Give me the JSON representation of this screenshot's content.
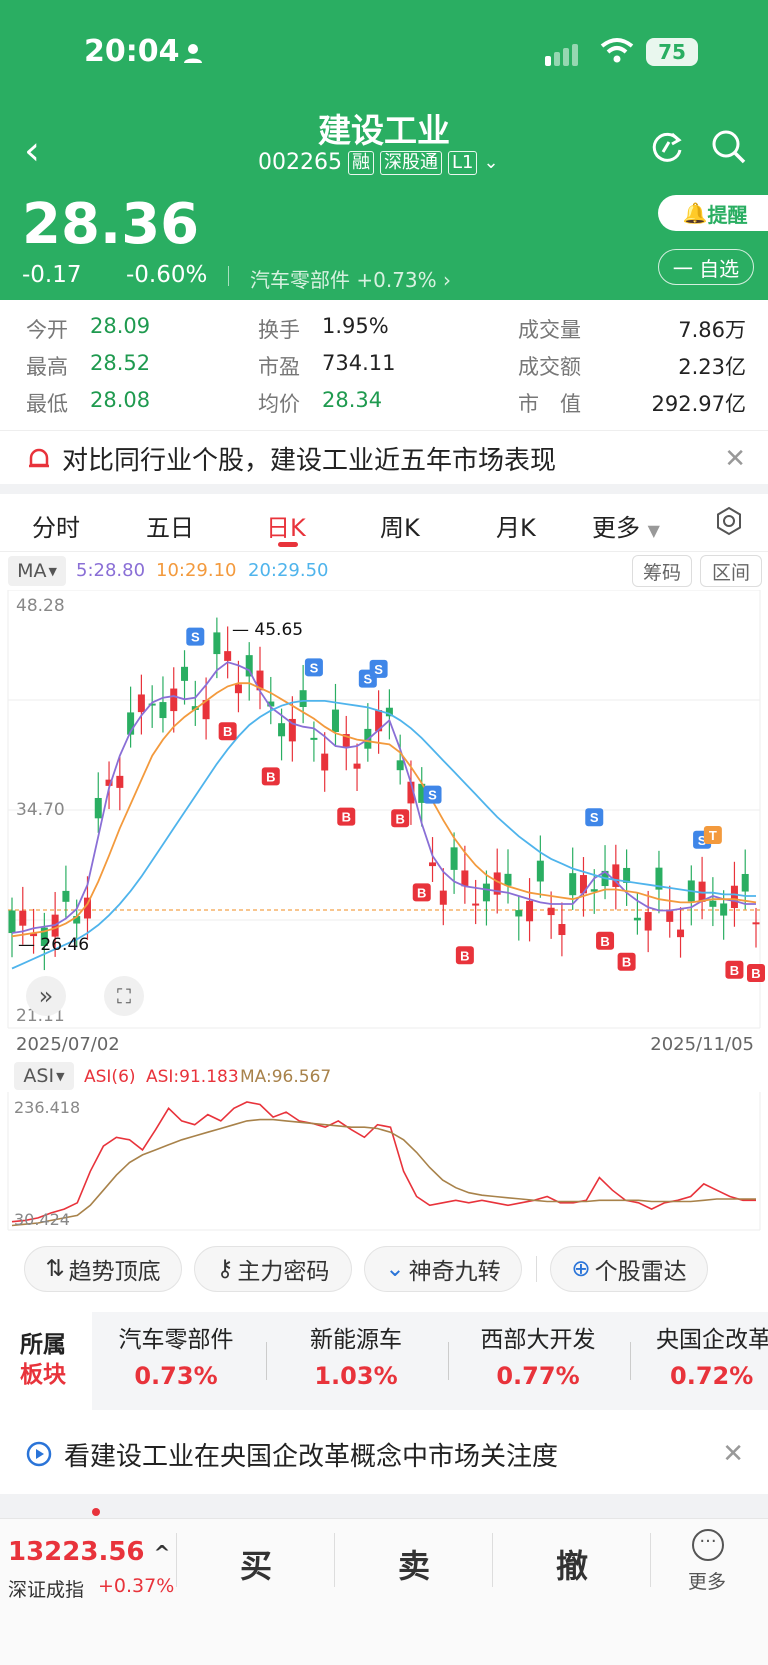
{
  "status": {
    "time": "20:04",
    "battery": "75"
  },
  "header": {
    "title": "建设工业",
    "code": "002265",
    "tags": [
      "融",
      "深股通",
      "L1"
    ],
    "price": "28.36",
    "change": "-0.17",
    "change_pct": "-0.60%",
    "sector": "汽车零部件 +0.73% ›",
    "remind_label": "提醒",
    "fav_label": "一 自选"
  },
  "stats": {
    "open_label": "今开",
    "open": "28.09",
    "high_label": "最高",
    "high": "28.52",
    "low_label": "最低",
    "low": "28.08",
    "turnover_label": "换手",
    "turnover": "1.95%",
    "pe_label": "市盈",
    "pe": "734.11",
    "avg_label": "均价",
    "avg": "28.34",
    "volume_label": "成交量",
    "volume": "7.86万",
    "amount_label": "成交额",
    "amount": "2.23亿",
    "mcap_label": "市　值",
    "mcap": "292.97亿"
  },
  "banner1": "对比同行业个股，建设工业近五年市场表现",
  "tabs": [
    "分时",
    "五日",
    "日K",
    "周K",
    "月K",
    "更多"
  ],
  "active_tab": "日K",
  "ma": {
    "label": "MA",
    "ma5": "5:28.80",
    "ma10": "10:29.10",
    "ma20": "20:29.50",
    "btn1": "筹码",
    "btn2": "区间"
  },
  "ylabels": {
    "top": "48.28",
    "mid": "34.70",
    "bottom": "21.11"
  },
  "marks": {
    "hi": "45.65",
    "lo": "26.46"
  },
  "dates": {
    "start": "2025/07/02",
    "end": "2025/11/05"
  },
  "asi": {
    "label": "ASI",
    "name": "ASI(6)",
    "value": "ASI:91.183",
    "ma": "MA:96.567",
    "top": "236.418",
    "bottom": "30.424"
  },
  "indicators": [
    "趋势顶底",
    "主力密码",
    "神奇九转",
    "个股雷达"
  ],
  "sector_panel": {
    "title1": "所属",
    "title2": "板块",
    "items": [
      {
        "name": "汽车零部件",
        "pct": "0.73%"
      },
      {
        "name": "新能源车",
        "pct": "1.03%"
      },
      {
        "name": "西部大开发",
        "pct": "0.77%"
      },
      {
        "name": "央国企改革",
        "pct": "0.72%"
      }
    ]
  },
  "banner2": "看建设工业在央国企改革概念中市场关注度",
  "footer": {
    "index_value": "13223.56",
    "index_name": "深证成指",
    "index_chg": "+0.37%",
    "buy": "买",
    "sell": "卖",
    "cancel": "撤",
    "more": "更多"
  },
  "colors": {
    "green": "#2aae62",
    "red": "#e8333b",
    "ma5": "#8a6fd6",
    "ma10": "#f39a3d",
    "ma20": "#4fb4ec"
  },
  "chart_data": {
    "type": "candlestick",
    "ylim": [
      21.11,
      48.28
    ],
    "ma_series": [
      {
        "name": "MA5",
        "values": [
          27,
          27.1,
          27.3,
          27.4,
          27.5,
          27.9,
          28.5,
          30,
          33,
          36,
          38,
          39.5,
          40.5,
          41.3,
          41.6,
          41.7,
          41.5,
          41.6,
          42.4,
          43.3,
          43.8,
          43.6,
          43.3,
          42,
          41,
          40.5,
          40,
          39.8,
          39.7,
          39.2,
          38.6,
          38.5,
          38.6,
          39,
          39.6,
          40.2,
          38.4,
          36.3,
          33.8,
          31.8,
          30.8,
          30.2,
          29.9,
          29.8,
          29.7,
          29.6,
          29.5,
          29.3,
          29.1,
          28.9,
          28.8,
          28.8,
          28.8,
          29.5,
          30.4,
          30.8,
          30.2,
          29.5,
          29,
          28.6,
          28.4,
          28.4,
          28.5,
          28.6,
          29,
          29.3,
          29.1,
          29,
          28.8,
          28.8
        ]
      },
      {
        "name": "MA10",
        "values": [
          26.8,
          26.9,
          27,
          27.1,
          27.3,
          27.6,
          28,
          28.8,
          30.2,
          31.8,
          33.5,
          35,
          36.5,
          38,
          39,
          39.8,
          40.4,
          40.9,
          41.4,
          41.9,
          42.3,
          42.5,
          42.5,
          42.2,
          41.9,
          41.5,
          41.1,
          40.7,
          40.3,
          39.8,
          39.4,
          39.2,
          39,
          38.9,
          38.8,
          38.7,
          38.2,
          37.3,
          36.3,
          35.2,
          34,
          32.9,
          32,
          31.2,
          30.6,
          30.2,
          29.9,
          29.7,
          29.5,
          29.4,
          29.3,
          29.2,
          29.1,
          29.3,
          29.5,
          29.7,
          29.7,
          29.6,
          29.5,
          29.3,
          29.1,
          29,
          28.9,
          28.9,
          29,
          29.1,
          29.1,
          29.1,
          29,
          28.9
        ]
      },
      {
        "name": "MA20",
        "values": [
          24.8,
          25.1,
          25.4,
          25.7,
          26,
          26.3,
          26.6,
          27,
          27.5,
          28.1,
          28.8,
          29.6,
          30.5,
          31.5,
          32.5,
          33.5,
          34.5,
          35.5,
          36.5,
          37.5,
          38.4,
          39.2,
          39.9,
          40.4,
          40.8,
          41.1,
          41.3,
          41.4,
          41.4,
          41.4,
          41.3,
          41.2,
          41.1,
          41,
          40.8,
          40.6,
          40.2,
          39.7,
          39.1,
          38.4,
          37.7,
          37,
          36.3,
          35.6,
          34.9,
          34.2,
          33.6,
          33,
          32.5,
          32,
          31.6,
          31.3,
          31,
          30.8,
          30.6,
          30.4,
          30.3,
          30.2,
          30.1,
          30,
          29.9,
          29.8,
          29.7,
          29.6,
          29.5,
          29.5,
          29.4,
          29.4,
          29.3,
          29.3
        ]
      }
    ],
    "asi_series": [
      {
        "name": "ASI(6)",
        "values": [
          0.05,
          0.06,
          0.08,
          0.12,
          0.15,
          0.2,
          0.45,
          0.65,
          0.72,
          0.7,
          0.62,
          0.78,
          0.95,
          0.85,
          0.82,
          0.9,
          0.85,
          0.95,
          1.0,
          0.98,
          0.88,
          0.92,
          0.85,
          0.83,
          0.8,
          0.85,
          0.78,
          0.72,
          0.82,
          0.8,
          0.45,
          0.25,
          0.18,
          0.2,
          0.22,
          0.2,
          0.22,
          0.2,
          0.18,
          0.2,
          0.22,
          0.25,
          0.2,
          0.2,
          0.22,
          0.4,
          0.3,
          0.22,
          0.2,
          0.15,
          0.2,
          0.22,
          0.25,
          0.35,
          0.3,
          0.25,
          0.22,
          0.22
        ]
      },
      {
        "name": "MA",
        "values": [
          0.02,
          0.03,
          0.04,
          0.06,
          0.08,
          0.1,
          0.18,
          0.3,
          0.42,
          0.52,
          0.58,
          0.62,
          0.66,
          0.7,
          0.73,
          0.76,
          0.79,
          0.82,
          0.85,
          0.86,
          0.86,
          0.85,
          0.84,
          0.83,
          0.82,
          0.81,
          0.8,
          0.8,
          0.79,
          0.76,
          0.7,
          0.6,
          0.48,
          0.38,
          0.32,
          0.28,
          0.26,
          0.25,
          0.24,
          0.23,
          0.22,
          0.21,
          0.21,
          0.21,
          0.21,
          0.22,
          0.22,
          0.22,
          0.22,
          0.21,
          0.21,
          0.21,
          0.21,
          0.22,
          0.23,
          0.23,
          0.23,
          0.23
        ]
      }
    ]
  }
}
